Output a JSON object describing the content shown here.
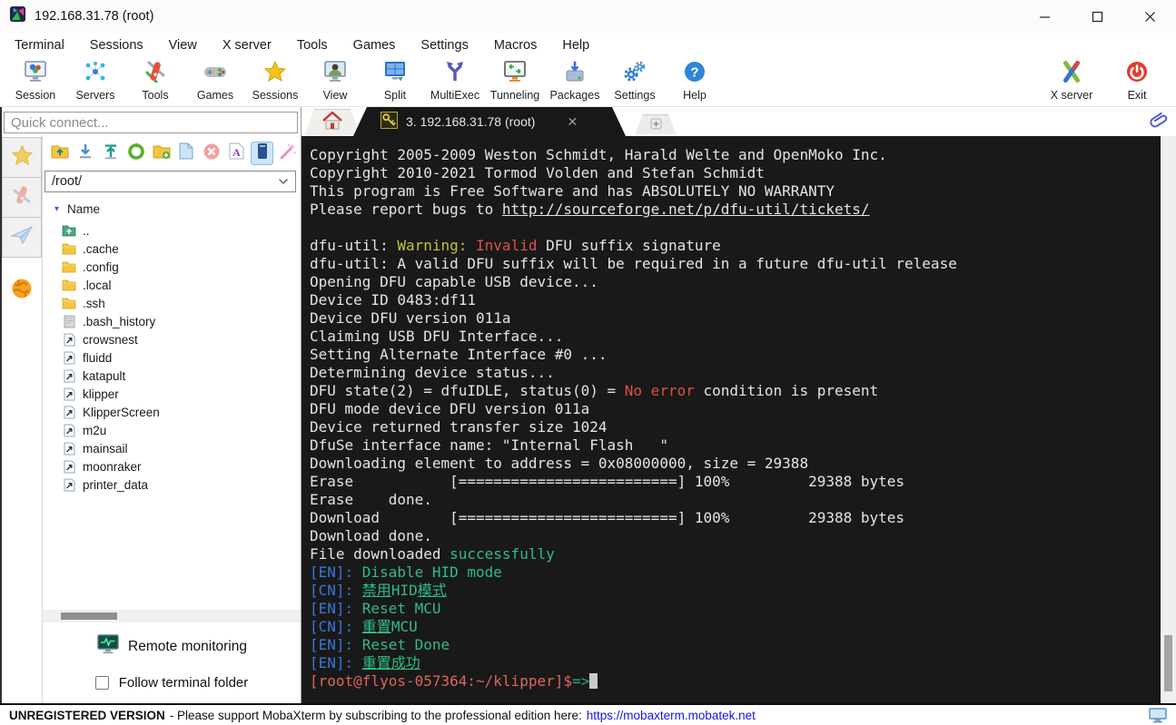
{
  "window": {
    "title": "192.168.31.78 (root)"
  },
  "menu": {
    "items": [
      "Terminal",
      "Sessions",
      "View",
      "X server",
      "Tools",
      "Games",
      "Settings",
      "Macros",
      "Help"
    ]
  },
  "toolbar": {
    "items": [
      {
        "label": "Session",
        "icon": "session"
      },
      {
        "label": "Servers",
        "icon": "servers"
      },
      {
        "label": "Tools",
        "icon": "tools"
      },
      {
        "label": "Games",
        "icon": "games"
      },
      {
        "label": "Sessions",
        "icon": "sessions-star"
      },
      {
        "label": "View",
        "icon": "view"
      },
      {
        "label": "Split",
        "icon": "split"
      },
      {
        "label": "MultiExec",
        "icon": "multiexec"
      },
      {
        "label": "Tunneling",
        "icon": "tunneling"
      },
      {
        "label": "Packages",
        "icon": "packages"
      },
      {
        "label": "Settings",
        "icon": "settings"
      },
      {
        "label": "Help",
        "icon": "help"
      }
    ],
    "right_items": [
      {
        "label": "X server",
        "icon": "xserver"
      },
      {
        "label": "Exit",
        "icon": "exit"
      }
    ]
  },
  "sidebar": {
    "quick_connect_placeholder": "Quick connect...",
    "tabs": [
      {
        "name": "sidebar-tab-sessions",
        "icon": "tab-star",
        "boxed": true
      },
      {
        "name": "sidebar-tab-tools",
        "icon": "tab-knife",
        "boxed": true
      },
      {
        "name": "sidebar-tab-macros",
        "icon": "tab-plane",
        "boxed": true
      },
      {
        "name": "sidebar-tab-sftp",
        "icon": "tab-globe",
        "boxed": false
      }
    ],
    "file_toolbar": [
      {
        "name": "go-to-parent-folder",
        "icon": "ftb-folderup"
      },
      {
        "name": "download-file",
        "icon": "ftb-download"
      },
      {
        "name": "upload-file",
        "icon": "ftb-upload"
      },
      {
        "name": "refresh-folder",
        "icon": "ftb-refresh"
      },
      {
        "name": "create-folder",
        "icon": "ftb-newfolder"
      },
      {
        "name": "create-file",
        "icon": "ftb-newfile"
      },
      {
        "name": "delete-file",
        "icon": "ftb-delete"
      },
      {
        "name": "rename-file",
        "icon": "ftb-font"
      },
      {
        "name": "sftp-panel-toggle",
        "icon": "ftb-panel",
        "active": true
      },
      {
        "name": "follow-wand",
        "icon": "ftb-wand"
      }
    ],
    "path": "/root/",
    "name_header": "Name",
    "files": [
      {
        "name": "..",
        "icon": "folder-up"
      },
      {
        "name": ".cache",
        "icon": "folder"
      },
      {
        "name": ".config",
        "icon": "folder"
      },
      {
        "name": ".local",
        "icon": "folder"
      },
      {
        "name": ".ssh",
        "icon": "folder"
      },
      {
        "name": ".bash_history",
        "icon": "file"
      },
      {
        "name": "crowsnest",
        "icon": "symlink"
      },
      {
        "name": "fluidd",
        "icon": "symlink"
      },
      {
        "name": "katapult",
        "icon": "symlink"
      },
      {
        "name": "klipper",
        "icon": "symlink"
      },
      {
        "name": "KlipperScreen",
        "icon": "symlink"
      },
      {
        "name": "m2u",
        "icon": "symlink"
      },
      {
        "name": "mainsail",
        "icon": "symlink"
      },
      {
        "name": "moonraker",
        "icon": "symlink"
      },
      {
        "name": "printer_data",
        "icon": "symlink"
      }
    ],
    "remote_monitoring_label": "Remote monitoring",
    "follow_terminal_label": "Follow terminal folder"
  },
  "tabbar": {
    "active_label": "3. 192.168.31.78 (root)"
  },
  "terminal": {
    "palette": {
      "background": "#191919",
      "default": "#e4e4e2",
      "yellow": "#c2c23a",
      "red": "#dc5148",
      "green": "#2ebd85",
      "blue": "#3a76db",
      "prompt": "#e0635c",
      "teal": "#2fa093",
      "cursor": "#c8ccc8"
    },
    "lines": [
      {
        "segs": [
          {
            "c": "d",
            "t": "Copyright 2005-2009 Weston Schmidt, Harald Welte and OpenMoko Inc."
          }
        ]
      },
      {
        "segs": [
          {
            "c": "d",
            "t": "Copyright 2010-2021 Tormod Volden and Stefan Schmidt"
          }
        ]
      },
      {
        "segs": [
          {
            "c": "d",
            "t": "This program is Free Software and has ABSOLUTELY NO WARRANTY"
          }
        ]
      },
      {
        "segs": [
          {
            "c": "d",
            "t": "Please report bugs to "
          },
          {
            "c": "u",
            "t": "http://sourceforge.net/p/dfu-util/tickets/"
          }
        ]
      },
      {
        "segs": []
      },
      {
        "segs": [
          {
            "c": "d",
            "t": "dfu-util: "
          },
          {
            "c": "y",
            "t": "Warning:"
          },
          {
            "c": "d",
            "t": " "
          },
          {
            "c": "r",
            "t": "Invalid"
          },
          {
            "c": "d",
            "t": " DFU suffix signature"
          }
        ]
      },
      {
        "segs": [
          {
            "c": "d",
            "t": "dfu-util: A valid DFU suffix will be required in a future dfu-util release"
          }
        ]
      },
      {
        "segs": [
          {
            "c": "d",
            "t": "Opening DFU capable USB device..."
          }
        ]
      },
      {
        "segs": [
          {
            "c": "d",
            "t": "Device ID 0483:df11"
          }
        ]
      },
      {
        "segs": [
          {
            "c": "d",
            "t": "Device DFU version 011a"
          }
        ]
      },
      {
        "segs": [
          {
            "c": "d",
            "t": "Claiming USB DFU Interface..."
          }
        ]
      },
      {
        "segs": [
          {
            "c": "d",
            "t": "Setting Alternate Interface #0 ..."
          }
        ]
      },
      {
        "segs": [
          {
            "c": "d",
            "t": "Determining device status..."
          }
        ]
      },
      {
        "segs": [
          {
            "c": "d",
            "t": "DFU state(2) = dfuIDLE, status(0) = "
          },
          {
            "c": "r",
            "t": "No error"
          },
          {
            "c": "d",
            "t": " condition is present"
          }
        ]
      },
      {
        "segs": [
          {
            "c": "d",
            "t": "DFU mode device DFU version 011a"
          }
        ]
      },
      {
        "segs": [
          {
            "c": "d",
            "t": "Device returned transfer size 1024"
          }
        ]
      },
      {
        "segs": [
          {
            "c": "d",
            "t": "DfuSe interface name: \"Internal Flash   \""
          }
        ]
      },
      {
        "segs": [
          {
            "c": "d",
            "t": "Downloading element to address = 0x08000000, size = 29388"
          }
        ]
      },
      {
        "segs": [
          {
            "c": "d",
            "t": "Erase           [=========================] 100%         29388 bytes"
          }
        ]
      },
      {
        "segs": [
          {
            "c": "d",
            "t": "Erase    done."
          }
        ]
      },
      {
        "segs": [
          {
            "c": "d",
            "t": "Download        [=========================] 100%         29388 bytes"
          }
        ]
      },
      {
        "segs": [
          {
            "c": "d",
            "t": "Download done."
          }
        ]
      },
      {
        "segs": [
          {
            "c": "d",
            "t": "File downloaded "
          },
          {
            "c": "g",
            "t": "successfully"
          }
        ]
      },
      {
        "segs": [
          {
            "c": "b",
            "t": "[EN]: "
          },
          {
            "c": "g",
            "t": "Disable HID mode"
          }
        ]
      },
      {
        "segs": [
          {
            "c": "b",
            "t": "[CN]: "
          },
          {
            "c": "gu",
            "t": "禁用"
          },
          {
            "c": "g",
            "t": "HID"
          },
          {
            "c": "gu",
            "t": "模式"
          }
        ]
      },
      {
        "segs": [
          {
            "c": "b",
            "t": "[EN]: "
          },
          {
            "c": "g",
            "t": "Reset MCU"
          }
        ]
      },
      {
        "segs": [
          {
            "c": "b",
            "t": "[CN]: "
          },
          {
            "c": "gu",
            "t": "重置"
          },
          {
            "c": "g",
            "t": "MCU"
          }
        ]
      },
      {
        "segs": [
          {
            "c": "b",
            "t": "[EN]: "
          },
          {
            "c": "g",
            "t": "Reset Done"
          }
        ]
      },
      {
        "segs": [
          {
            "c": "b",
            "t": "[EN]: "
          },
          {
            "c": "gu",
            "t": "重置成功"
          }
        ]
      },
      {
        "segs": [
          {
            "c": "s",
            "t": "[root@flyos-057364:~/klipper]$"
          },
          {
            "c": "c",
            "t": "=>"
          },
          {
            "c": "cursor",
            "t": " "
          }
        ]
      }
    ]
  },
  "statusbar": {
    "version": "UNREGISTERED VERSION",
    "message": "-  Please support MobaXterm by subscribing to the professional edition here:",
    "link": "https://mobaxterm.mobatek.net"
  }
}
